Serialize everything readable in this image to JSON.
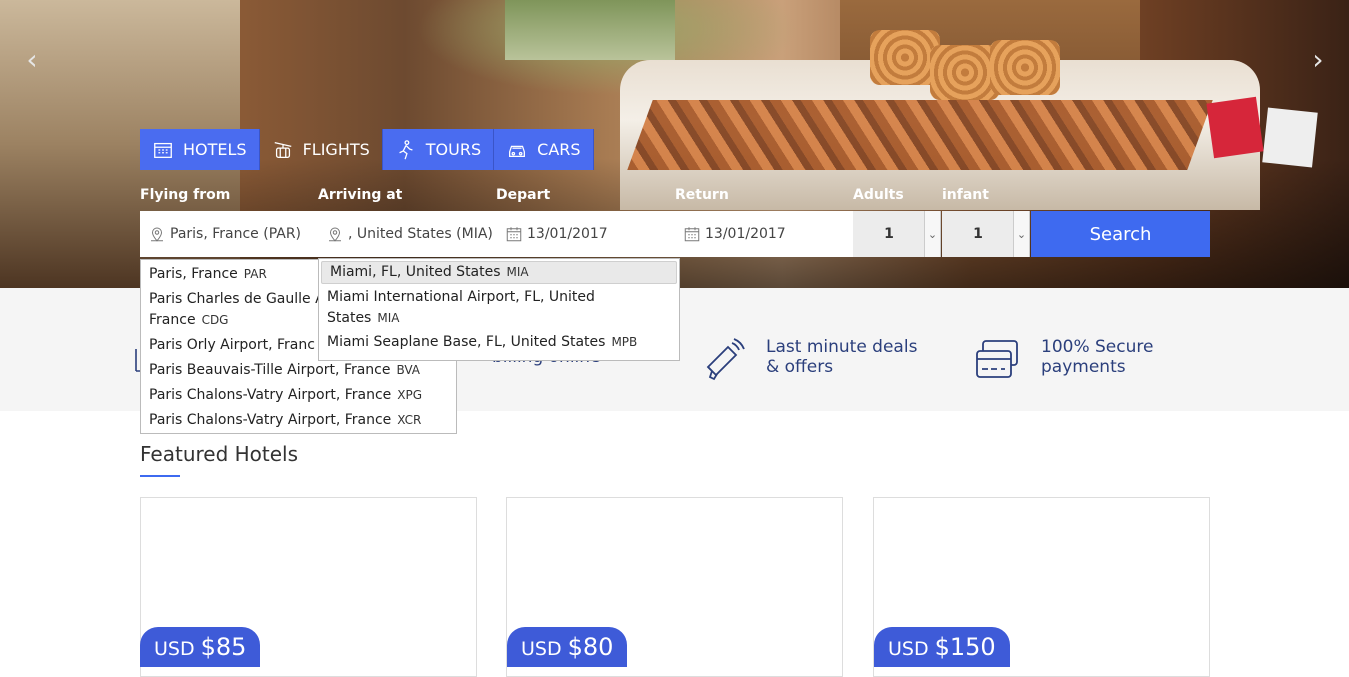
{
  "tabs": [
    {
      "label": "HOTELS",
      "icon": "hotel-icon",
      "active": true
    },
    {
      "label": "FLIGHTS",
      "icon": "cable-car-icon",
      "active": false
    },
    {
      "label": "TOURS",
      "icon": "walking-person-icon",
      "active": true
    },
    {
      "label": "CARS",
      "icon": "car-icon",
      "active": true
    }
  ],
  "search": {
    "labels": {
      "from": "Flying from",
      "to": "Arriving at",
      "depart": "Depart",
      "return": "Return",
      "adults": "Adults",
      "infant": "infant"
    },
    "from_value": "Paris, France (PAR)",
    "to_value": ", United States (MIA)",
    "depart_value": "13/01/2017",
    "return_value": "13/01/2017",
    "adults_value": "1",
    "infant_value": "1",
    "button_label": "Search"
  },
  "from_dropdown": [
    {
      "name": "Paris, France",
      "code": "PAR"
    },
    {
      "name": "Paris Charles de Gaulle A",
      "code": ""
    },
    {
      "name": "France",
      "code": "CDG"
    },
    {
      "name": "Paris Orly Airport, Franc",
      "code": ""
    },
    {
      "name": "Paris Beauvais-Tille Airport, France",
      "code": "BVA"
    },
    {
      "name": "Paris Chalons-Vatry Airport, France",
      "code": "XPG"
    },
    {
      "name": "Paris Chalons-Vatry Airport, France",
      "code": "XCR"
    }
  ],
  "to_dropdown": [
    {
      "name": "Miami, FL, United States",
      "code": "MIA",
      "selected": true
    },
    {
      "name": "Miami International Airport, FL, United",
      "code": ""
    },
    {
      "name": "States",
      "code": "MIA"
    },
    {
      "name": "Miami Seaplane Base, FL, United States",
      "code": "MPB"
    }
  ],
  "features": [
    {
      "line1": "",
      "line2": "billing online",
      "icon": "document-icon"
    },
    {
      "line1": "Last minute deals",
      "line2": "& offers",
      "icon": "megaphone-icon"
    },
    {
      "line1": "100% Secure",
      "line2": "payments",
      "icon": "credit-card-icon"
    }
  ],
  "featured": {
    "title": "Featured Hotels",
    "hotels": [
      {
        "currency": "USD",
        "price": "$85"
      },
      {
        "currency": "USD",
        "price": "$80"
      },
      {
        "currency": "USD",
        "price": "$150"
      }
    ]
  },
  "carousel": {
    "prev": "‹",
    "next": "›"
  },
  "colors": {
    "accent": "#3e6af0",
    "tab_blue": "#4a6cf0",
    "feature_text": "#2b3f7c"
  }
}
